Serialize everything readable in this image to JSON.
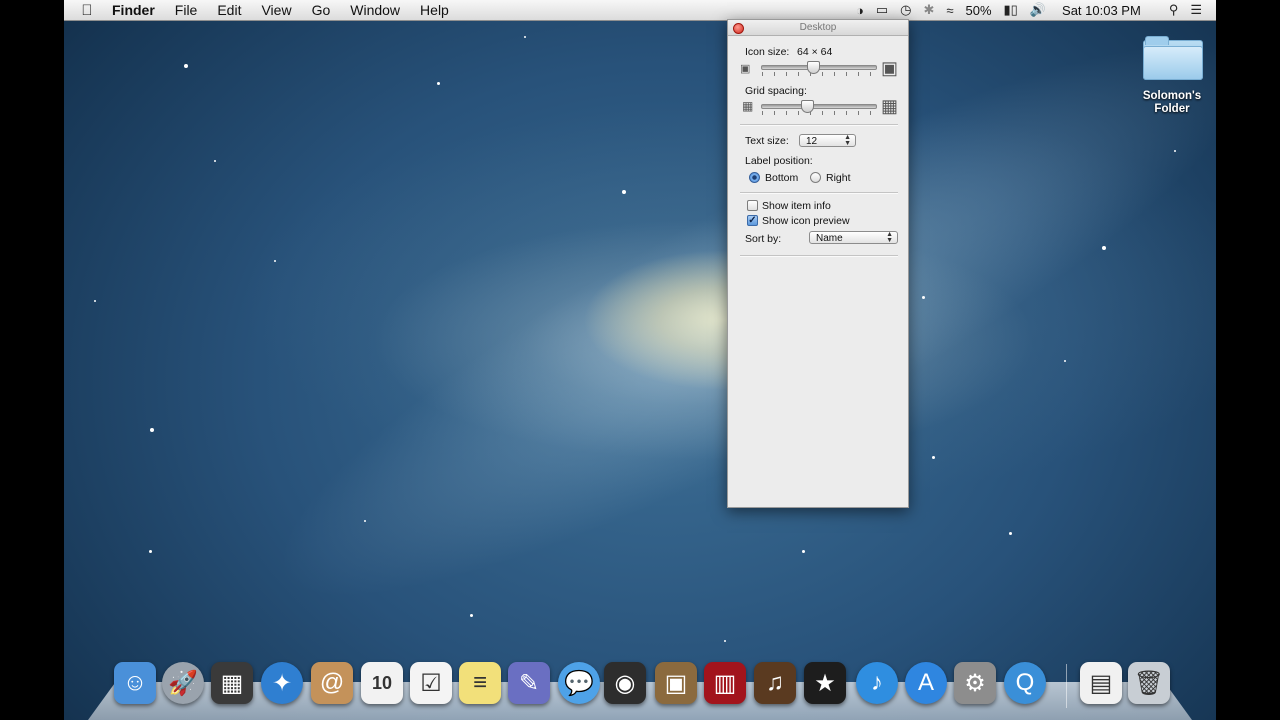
{
  "menubar": {
    "app_name": "Finder",
    "menus": [
      "File",
      "Edit",
      "View",
      "Go",
      "Window",
      "Help"
    ],
    "battery": "50%",
    "clock": "Sat 10:03 PM"
  },
  "panel": {
    "title": "Desktop",
    "icon_size_label": "Icon size:",
    "icon_size_value": "64 × 64",
    "grid_spacing_label": "Grid spacing:",
    "text_size_label": "Text size:",
    "text_size_value": "12",
    "label_position_label": "Label position:",
    "label_position_options": [
      "Bottom",
      "Right"
    ],
    "label_position_selected": "Bottom",
    "show_item_info_label": "Show item info",
    "show_item_info_checked": false,
    "show_icon_preview_label": "Show icon preview",
    "show_icon_preview_checked": true,
    "sort_by_label": "Sort by:",
    "sort_by_value": "Name"
  },
  "desktop": {
    "folder_label": "Solomon's Folder"
  },
  "dock": {
    "items": [
      {
        "name": "finder-icon",
        "color": "#4a90d9"
      },
      {
        "name": "launchpad-icon",
        "color": "#9aa3ad"
      },
      {
        "name": "mission-control-icon",
        "color": "#3a3a3a"
      },
      {
        "name": "safari-icon",
        "color": "#2f7fd1"
      },
      {
        "name": "contacts-icon",
        "color": "#c4925a"
      },
      {
        "name": "calendar-icon",
        "color": "#f2f2f2"
      },
      {
        "name": "reminders-icon",
        "color": "#f4f4f4"
      },
      {
        "name": "notes-icon",
        "color": "#f2e07a"
      },
      {
        "name": "mail-icon",
        "color": "#6a6fc2"
      },
      {
        "name": "messages-icon",
        "color": "#4ea2e8"
      },
      {
        "name": "facetime-icon",
        "color": "#2d2d2d"
      },
      {
        "name": "iphoto-icon",
        "color": "#8b6a3e"
      },
      {
        "name": "photo-booth-icon",
        "color": "#a2141c"
      },
      {
        "name": "garageband-icon",
        "color": "#5a3a20"
      },
      {
        "name": "imovie-icon",
        "color": "#1d1d1d"
      },
      {
        "name": "itunes-icon",
        "color": "#2f8ee0"
      },
      {
        "name": "app-store-icon",
        "color": "#2f86e0"
      },
      {
        "name": "system-preferences-icon",
        "color": "#8d8d8d"
      },
      {
        "name": "quicktime-icon",
        "color": "#3a8fd8"
      },
      {
        "name": "documents-stack-icon",
        "color": "#f1f1f1"
      },
      {
        "name": "trash-icon",
        "color": "#c8ced4"
      }
    ]
  }
}
